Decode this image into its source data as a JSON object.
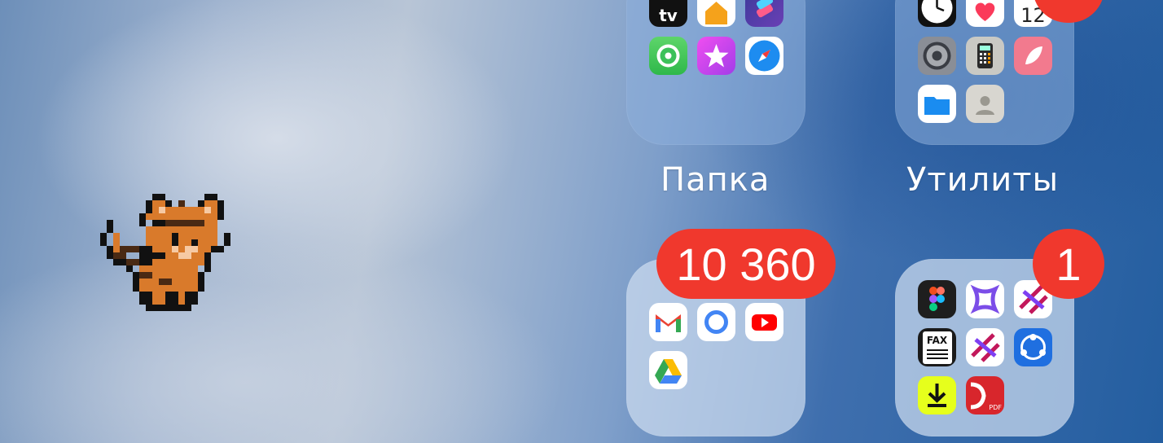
{
  "folders": {
    "top_left": {
      "name": "Папка",
      "apps": [
        "apple-tv-icon",
        "home-icon",
        "shortcuts-icon",
        "find-my-icon",
        "itunes-store-icon",
        "safari-icon"
      ]
    },
    "top_right": {
      "name": "Утилиты",
      "calendar_day": "12",
      "apps": [
        "clock-icon",
        "health-icon",
        "calendar-icon",
        "settings-icon",
        "calculator-icon",
        "feather-app-icon",
        "files-icon",
        "contacts-icon"
      ]
    },
    "bottom_left": {
      "badge": "10 360",
      "apps": [
        "gmail-icon",
        "google-icon",
        "youtube-icon",
        "google-drive-icon"
      ]
    },
    "bottom_right": {
      "badge": "1",
      "fax_label": "FAX",
      "pdf_label": "PDF",
      "apps": [
        "figma-icon",
        "purple-app-icon",
        "cross-arrows-icon",
        "fax-icon",
        "cross-arrows-app-icon",
        "share-icon",
        "downloader-icon",
        "pdf-app-icon"
      ]
    }
  },
  "apple_tv_label": "tv",
  "colors": {
    "badge": "#f0382d",
    "label": "#ffffff"
  }
}
